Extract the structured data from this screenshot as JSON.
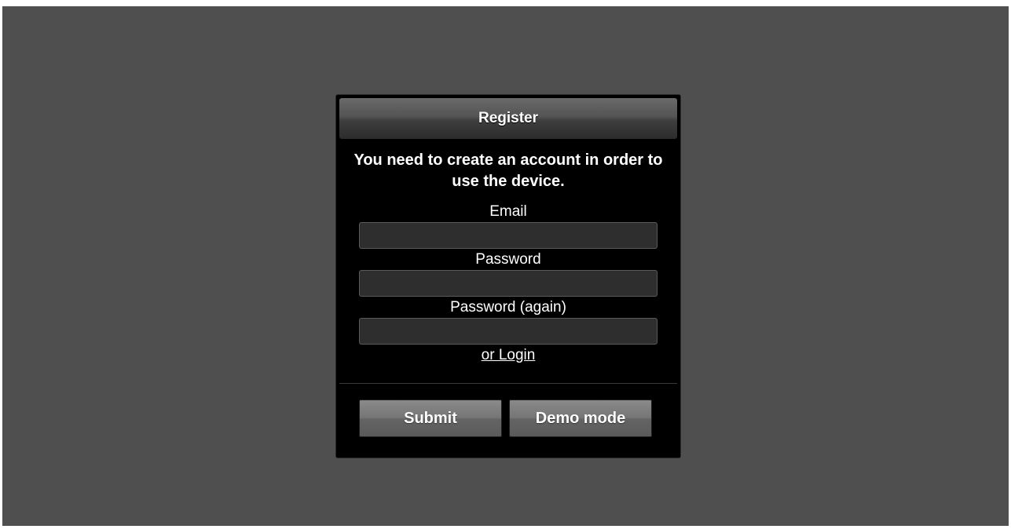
{
  "dialog": {
    "title": "Register",
    "message": "You need to create an account in order to use the device.",
    "fields": {
      "email": {
        "label": "Email",
        "value": "",
        "placeholder": ""
      },
      "password": {
        "label": "Password",
        "value": "",
        "placeholder": ""
      },
      "password_again": {
        "label": "Password (again)",
        "value": "",
        "placeholder": ""
      }
    },
    "login_link": "or Login",
    "buttons": {
      "submit": "Submit",
      "demo": "Demo mode"
    }
  },
  "colors": {
    "background": "#4f4f4f",
    "dialog": "#000000",
    "button": "#767676",
    "input": "#2e2e2e"
  }
}
